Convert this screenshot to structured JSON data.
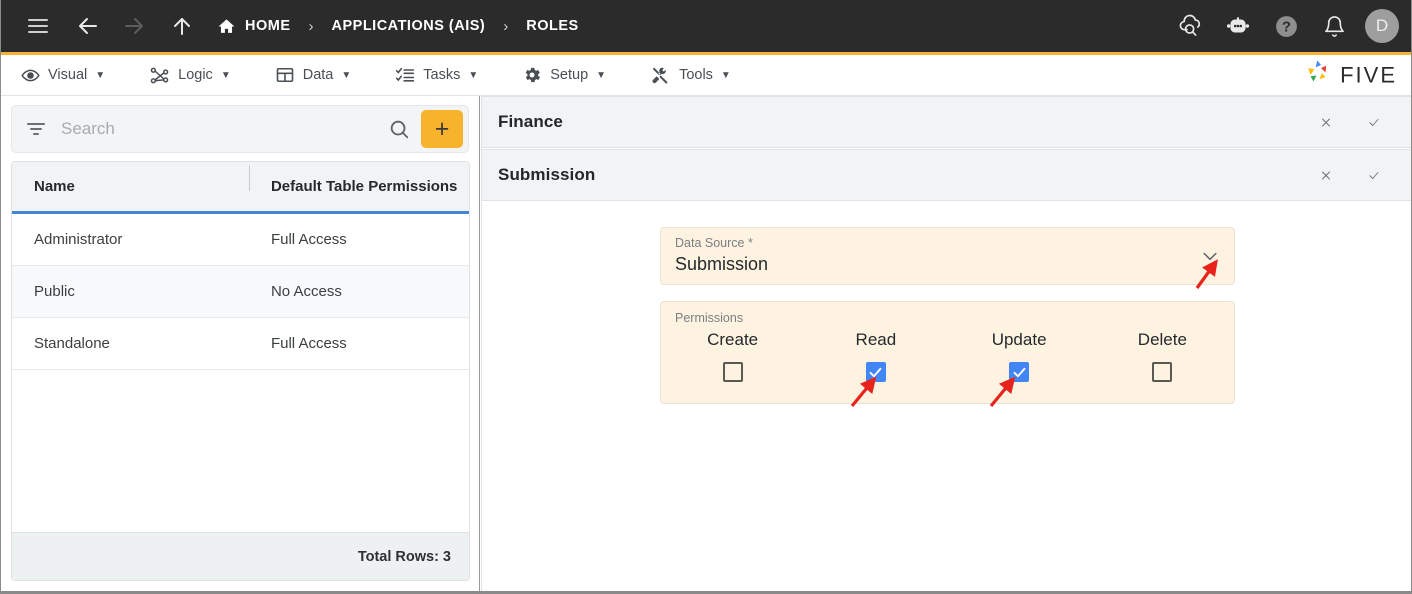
{
  "topbar": {
    "menu_icon": "hamburger-icon",
    "back_icon": "arrow-left-icon",
    "forward_icon": "arrow-right-icon",
    "up_icon": "arrow-up-icon",
    "home_icon": "home-icon",
    "breadcrumbs": [
      {
        "label": "HOME",
        "icon": "home-icon"
      },
      {
        "label": "APPLICATIONS (AIS)"
      },
      {
        "label": "ROLES"
      }
    ],
    "separator": "›",
    "right_icons": [
      {
        "name": "cloud-search-icon"
      },
      {
        "name": "bot-assistant-icon"
      },
      {
        "name": "help-icon"
      },
      {
        "name": "notifications-bell-icon"
      }
    ],
    "avatar_initial": "D"
  },
  "menubar": {
    "items": [
      {
        "label": "Visual",
        "icon": "eye-icon"
      },
      {
        "label": "Logic",
        "icon": "nodes-icon"
      },
      {
        "label": "Data",
        "icon": "table-icon"
      },
      {
        "label": "Tasks",
        "icon": "checklist-icon"
      },
      {
        "label": "Setup",
        "icon": "gear-icon"
      },
      {
        "label": "Tools",
        "icon": "tools-icon"
      }
    ],
    "caret": "▼",
    "brand": "FIVE"
  },
  "sidebar": {
    "search": {
      "placeholder": "Search",
      "value": "",
      "filter_icon": "filter-icon",
      "search_icon": "search-icon",
      "add_label": "+"
    },
    "grid": {
      "columns": [
        "Name",
        "Default Table Permissions"
      ],
      "rows": [
        {
          "name": "Administrator",
          "permissions": "Full Access"
        },
        {
          "name": "Public",
          "permissions": "No Access"
        },
        {
          "name": "Standalone",
          "permissions": "Full Access"
        }
      ],
      "footer": "Total Rows: 3"
    }
  },
  "main": {
    "sections": [
      {
        "title": "Finance",
        "close_icon": "close-icon",
        "confirm_icon": "check-icon"
      },
      {
        "title": "Submission",
        "close_icon": "close-icon",
        "confirm_icon": "check-icon"
      }
    ],
    "data_source": {
      "label": "Data Source *",
      "value": "Submission",
      "caret_icon": "chevron-down-icon"
    },
    "permissions": {
      "legend": "Permissions",
      "options": [
        {
          "label": "Create",
          "checked": false
        },
        {
          "label": "Read",
          "checked": true
        },
        {
          "label": "Update",
          "checked": true
        },
        {
          "label": "Delete",
          "checked": false
        }
      ]
    }
  },
  "colors": {
    "accent": "#f5b335",
    "topbar_bg": "#2b2b2b",
    "checkbox_checked": "#4285f4",
    "grid_underline": "#4285d6",
    "field_bg": "#fdf3e0",
    "annotation": "#e8231c"
  }
}
